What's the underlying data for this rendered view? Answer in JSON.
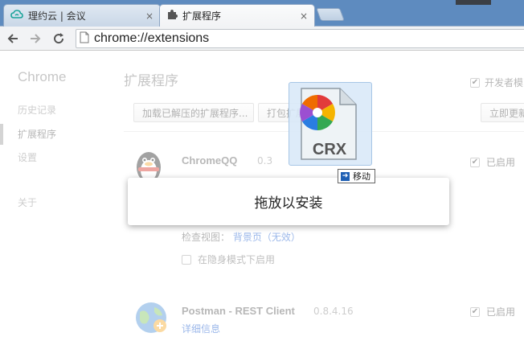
{
  "tabs": [
    {
      "title": "理约云 | 会议",
      "close": "×"
    },
    {
      "title": "扩展程序",
      "close": "×"
    }
  ],
  "toolbar": {
    "back_icon": "back-arrow-icon",
    "forward_icon": "forward-arrow-icon",
    "reload_icon": "reload-icon",
    "url": "chrome://extensions"
  },
  "sidebar": {
    "title": "Chrome",
    "items": [
      {
        "label": "历史记录"
      },
      {
        "label": "扩展程序"
      },
      {
        "label": "设置"
      },
      {
        "label": "关于"
      }
    ]
  },
  "main": {
    "title": "扩展程序",
    "developer_mode_label": "开发者模",
    "developer_mode_checked": true,
    "buttons": {
      "load_unpacked": "加载已解压的扩展程序...",
      "pack": "打包扩展",
      "update_now": "立即更新"
    }
  },
  "extensions": [
    {
      "name": "ChromeQQ",
      "version": "0.3",
      "enabled_label": "已启用",
      "enabled": true,
      "inspect_label": "检查视图：",
      "inspect_link": "背景页（无效）",
      "incognito_label": "在隐身模式下启用"
    },
    {
      "name": "Postman - REST Client",
      "version": "0.8.4.16",
      "enabled_label": "已启用",
      "enabled": true,
      "details_link": "详细信息"
    }
  ],
  "overlay": {
    "drop_text": "拖放以安装"
  },
  "drag": {
    "file_label": "CRX",
    "move_label": "移动"
  },
  "colors": {
    "tabstrip": "#5e8bbf",
    "link": "#1155cc",
    "checkbox_check": "#333333"
  }
}
